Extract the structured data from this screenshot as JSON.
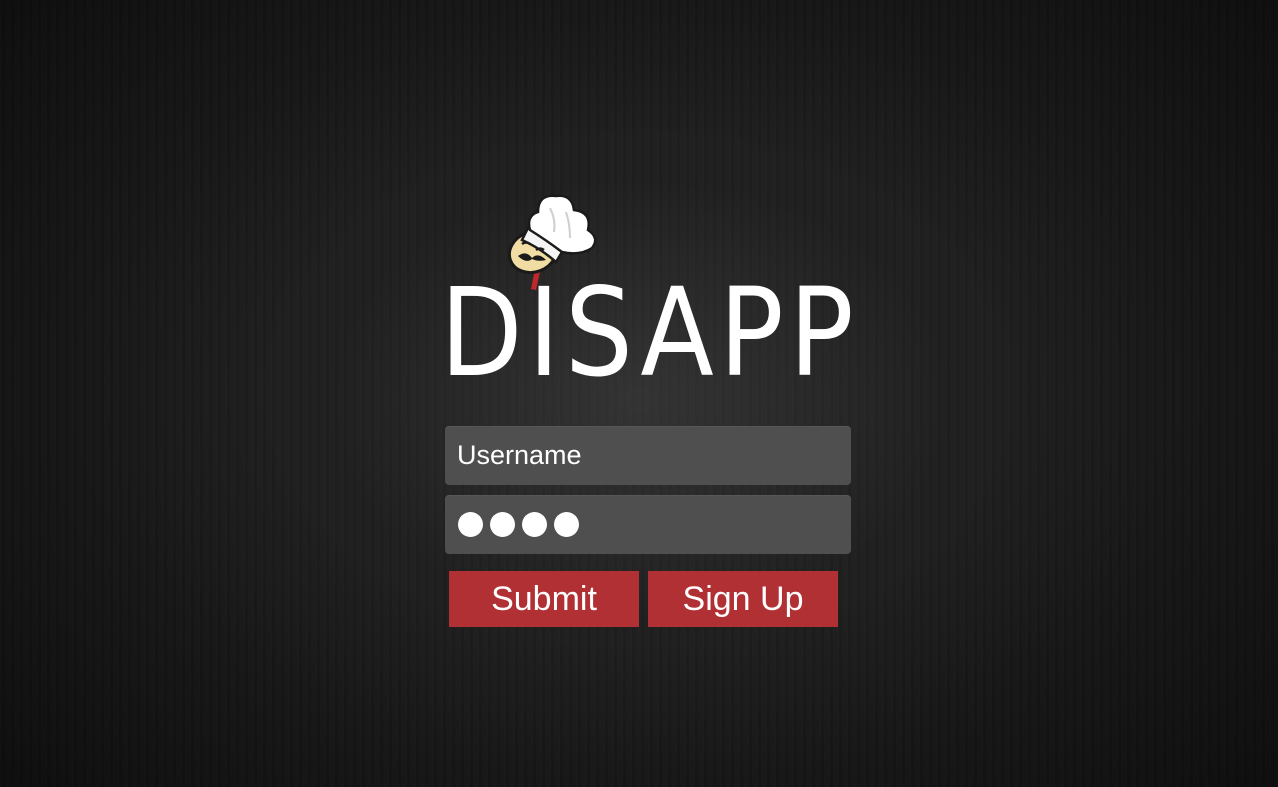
{
  "app": {
    "logo_text": "DISAPP",
    "mascot_icon": "chef-mascot-icon"
  },
  "form": {
    "username_placeholder": "Username",
    "password_masked": "●●●●",
    "submit_label": "Submit",
    "signup_label": "Sign Up"
  },
  "colors": {
    "background": "#1c1c1c",
    "field": "#4f4f4f",
    "button": "#b03034",
    "text": "#ffffff"
  }
}
